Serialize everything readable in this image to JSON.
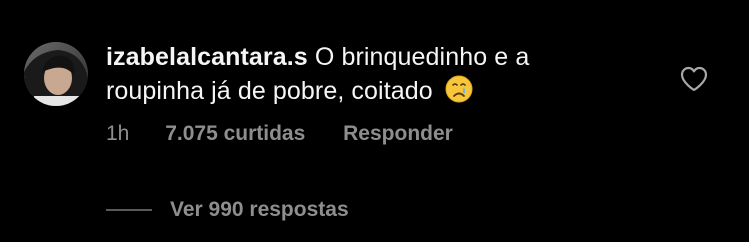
{
  "comment": {
    "username": "izabelalcantara.s",
    "text": "O brinquedinho e a roupinha já de pobre, coitado",
    "emoji_icon": "crying-face-emoji",
    "time": "1h",
    "likes": "7.075 curtidas",
    "reply_label": "Responder",
    "view_replies_label": "Ver 990 respostas",
    "like_icon": "heart-outline-icon"
  },
  "colors": {
    "background": "#000000",
    "primary_text": "#f5f5f5",
    "secondary_text": "#8e8e8e"
  }
}
